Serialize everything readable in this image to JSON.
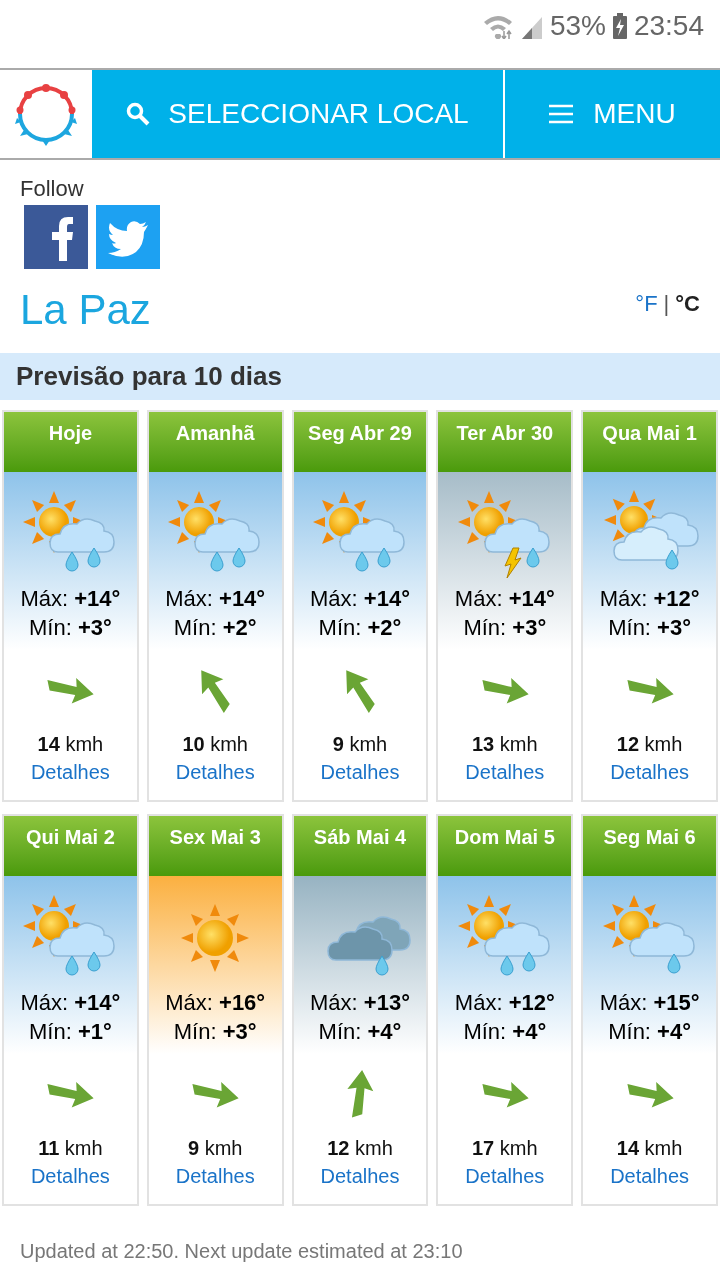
{
  "status_bar": {
    "battery": "53%",
    "time": "23:54"
  },
  "header": {
    "search_button": "SELECCIONAR LOCAL",
    "menu_button": "MENU"
  },
  "follow": {
    "label": "Follow"
  },
  "city": "La Paz",
  "units": [
    {
      "label": "°F",
      "selected": false
    },
    {
      "label": "|"
    },
    {
      "label": "°C",
      "selected": true
    }
  ],
  "section_title": "Previsão para 10 dias",
  "days": [
    {
      "label": "Hoje",
      "kind": "sun-rain",
      "arrow": {
        "kind": "east"
      },
      "max": "Máx: **+14°**",
      "min": "Mín: **+3°**",
      "wind": "**14** kmh",
      "link": "Detalhes"
    },
    {
      "label": "Amanhã",
      "kind": "sun-rain",
      "arrow": {
        "kind": "northwest"
      },
      "max": "Máx: **+14°**",
      "min": "Mín: **+2°**",
      "wind": "**10** kmh",
      "link": "Detalhes"
    },
    {
      "label": "Seg Abr 29",
      "kind": "sun-rain",
      "arrow": {
        "kind": "northwest"
      },
      "max": "Máx: **+14°**",
      "min": "Mín: **+2°**",
      "wind": "**9** kmh",
      "link": "Detalhes"
    },
    {
      "label": "Ter Abr 30",
      "kind": "storm",
      "arrow": {
        "kind": "east"
      },
      "max": "Máx: **+14°**",
      "min": "Mín: **+3°**",
      "wind": "**13** kmh",
      "link": "Detalhes"
    },
    {
      "label": "Qua Mai 1",
      "kind": "clouds",
      "arrow": {
        "kind": "east"
      },
      "max": "Máx: **+12°**",
      "min": "Mín: **+3°**",
      "wind": "**12** kmh",
      "link": "Detalhes"
    },
    {
      "label": "Qui Mai 2",
      "kind": "sun-rain",
      "arrow": {
        "kind": "east"
      },
      "max": "Máx: **+14°**",
      "min": "Mín: **+1°**",
      "wind": "**11** kmh",
      "link": "Detalhes"
    },
    {
      "label": "Sex Mai 3",
      "kind": "sunny",
      "arrow": {
        "kind": "east"
      },
      "max": "Máx: **+16°**",
      "min": "Mín: **+3°**",
      "wind": "**9** kmh",
      "link": "Detalhes"
    },
    {
      "label": "Sáb Mai 4",
      "kind": "overcast",
      "arrow": {
        "kind": "north"
      },
      "max": "Máx: **+13°**",
      "min": "Mín: **+4°**",
      "wind": "**12** kmh",
      "link": "Detalhes"
    },
    {
      "label": "Dom Mai 5",
      "kind": "sun-rain",
      "arrow": {
        "kind": "east"
      },
      "max": "Máx: **+12°**",
      "min": "Mín: **+4°**",
      "wind": "**17** kmh",
      "link": "Detalhes"
    },
    {
      "label": "Seg Mai 6",
      "kind": "shower",
      "arrow": {
        "kind": "east"
      },
      "max": "Máx: **+15°**",
      "min": "Mín: **+4°**",
      "wind": "**14** kmh",
      "link": "Detalhes"
    }
  ],
  "footer": "Updated at 22:50. Next update estimated at 23:10"
}
